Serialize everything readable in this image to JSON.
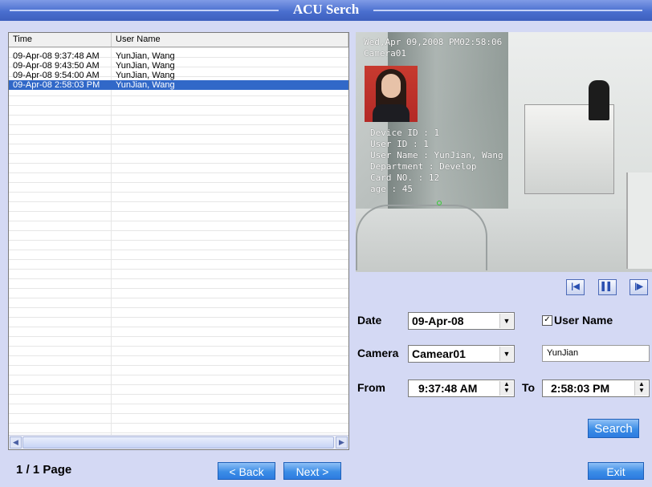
{
  "window": {
    "title": "ACU Serch"
  },
  "list": {
    "columns": [
      "Time",
      "User Name"
    ],
    "rows": [
      {
        "time": "09-Apr-08 9:37:48 AM",
        "user": "YunJian, Wang"
      },
      {
        "time": "09-Apr-08 9:43:50 AM",
        "user": "YunJian, Wang"
      },
      {
        "time": "09-Apr-08 9:54:00 AM",
        "user": "YunJian, Wang"
      },
      {
        "time": "09-Apr-08 2:58:03 PM",
        "user": "YunJian, Wang"
      }
    ],
    "selected_row": 3
  },
  "paging": {
    "page_text": "1 / 1 Page",
    "back_label": "< Back",
    "next_label": "Next >"
  },
  "video": {
    "timestamp": "Wed,Apr 09,2008 PM02:58:06",
    "camera": "Camera01",
    "overlay": [
      "Device ID : 1",
      "User ID : 1",
      "User Name : YunJian, Wang",
      "Department : Develop",
      "Card NO. : 12",
      "age : 45"
    ]
  },
  "playback": {
    "first_icon": "skip-to-start-icon",
    "pause_icon": "pause-icon",
    "next_icon": "step-forward-icon"
  },
  "form": {
    "date_label": "Date",
    "date_value": "09-Apr-08",
    "username_check_label": "User Name",
    "username_checked": true,
    "camera_label": "Camera",
    "camera_value": "Camear01",
    "username_value": "YunJian",
    "from_label": "From",
    "from_value": "9:37:48 AM",
    "to_label": "To",
    "to_value": "2:58:03 PM",
    "search_label": "Search",
    "exit_label": "Exit"
  }
}
